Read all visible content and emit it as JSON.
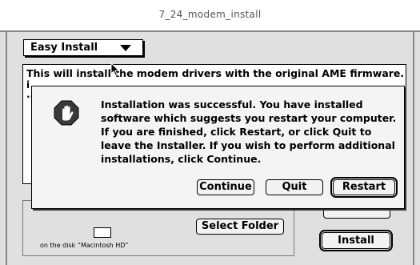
{
  "window": {
    "title": "7_24_modem_install"
  },
  "install_type": {
    "selected": "Easy Install"
  },
  "info": {
    "text": "This will install the modem drivers with the original AME firmware. To",
    "fragment_1": "i",
    "fragment_2": "..."
  },
  "destination": {
    "disk_text": "on the disk “Macintosh HD”",
    "select_folder_label": "Select Folder"
  },
  "main_buttons": {
    "quit_label": "Quit",
    "install_label": "Install"
  },
  "dialog": {
    "icon": "stop-hand-icon",
    "message": "Installation was successful. You have installed software which suggests you restart your computer. If you are finished, click Restart, or click Quit to leave the Installer. If you wish to perform additional installations, click Continue.",
    "continue_label": "Continue",
    "quit_label": "Quit",
    "restart_label": "Restart"
  }
}
